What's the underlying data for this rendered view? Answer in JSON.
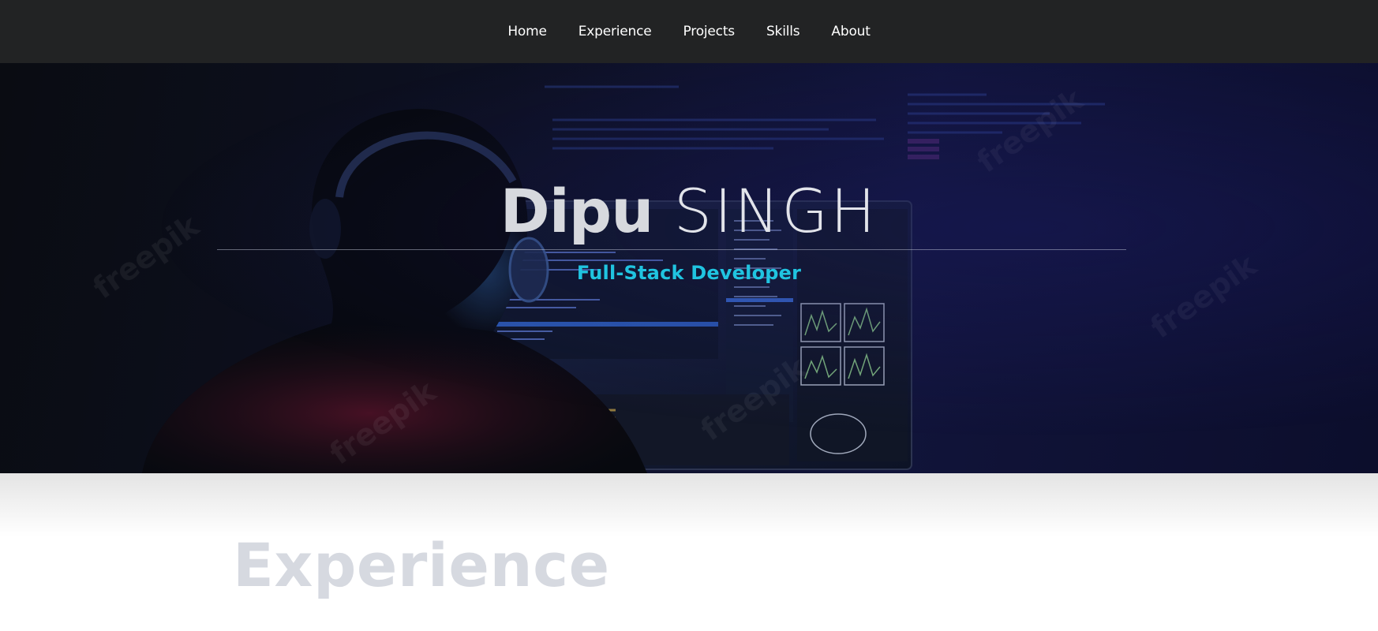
{
  "nav": {
    "items": [
      {
        "label": "Home"
      },
      {
        "label": "Experience"
      },
      {
        "label": "Projects"
      },
      {
        "label": "Skills"
      },
      {
        "label": "About"
      }
    ]
  },
  "hero": {
    "first_name": "Dipu",
    "last_name": "SINGH",
    "role": "Full-Stack Developer",
    "accent_color": "#20c4e0"
  },
  "watermark": {
    "text": "freepik"
  },
  "sections": {
    "experience_heading": "Experience"
  }
}
